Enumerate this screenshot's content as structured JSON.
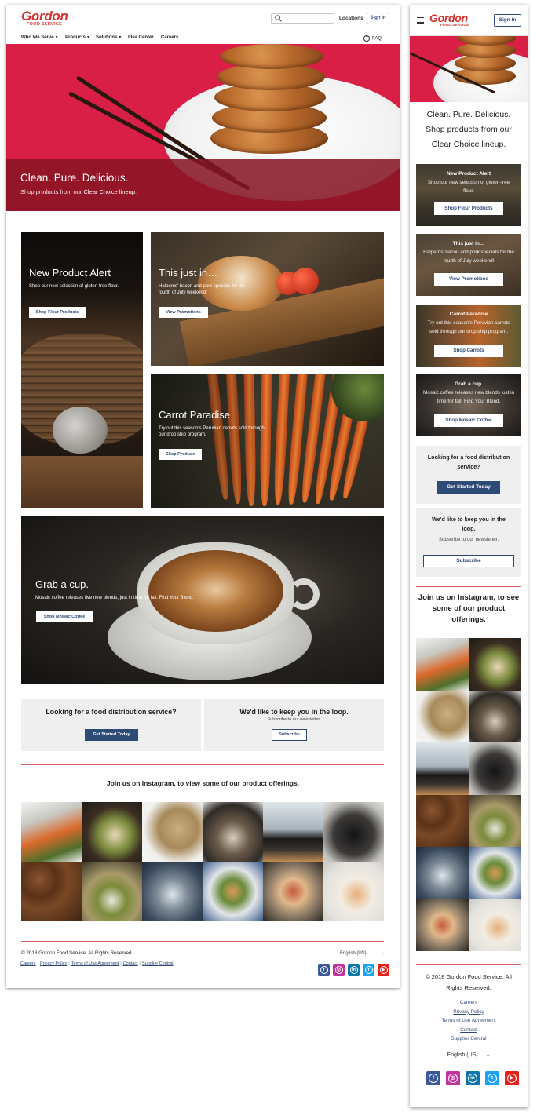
{
  "colors": {
    "brand_red": "#d1342e",
    "navy": "#2e4b78",
    "hero_red": "#d91f45",
    "hero_band": "#87141f",
    "info_gray": "#efefef",
    "divider_red": "#d66060",
    "facebook": "#3b5998",
    "instagram": "#c2339b",
    "linkedin": "#0e76a8",
    "twitter": "#1da1f2",
    "youtube": "#e62117"
  },
  "brand": {
    "name": "Gordon",
    "sub": "FOOD SERVICE"
  },
  "header": {
    "search_placeholder": "",
    "locations": "Locations",
    "sign_in": "Sign In",
    "faq": "FAQ",
    "nav": [
      {
        "label": "Who We Serve",
        "has_menu": true
      },
      {
        "label": "Products",
        "has_menu": true
      },
      {
        "label": "Solutions",
        "has_menu": true
      },
      {
        "label": "Idea Center",
        "has_menu": false
      },
      {
        "label": "Careers",
        "has_menu": false
      }
    ]
  },
  "hero": {
    "title": "Clean. Pure. Delicious.",
    "subtitle": "Shop products from our ",
    "link": "Clear Choice lineup",
    "period": ".",
    "mobile_line1": "Clean. Pure. Delicious.",
    "mobile_line2": "Shop products from our"
  },
  "promos": [
    {
      "title": "New Product Alert",
      "text": "Shop our new selection of gluten-free flour.",
      "button": "Shop Flour Products"
    },
    {
      "title": "This just in…",
      "text": "Halperns' bacon and pork specials for the fourth of July weekend!",
      "button": "View Promotions"
    },
    {
      "title": "Carrot Paradise",
      "text": "Try out this season's Peruvian carrots sold through our drop ship program.",
      "button": "Shop Produce"
    },
    {
      "title": "Grab a cup.",
      "text": "Mosaic coffee releases five new blends, just in time for fall. Find Your Blend.",
      "button": "Shop Mosaic Coffee"
    }
  ],
  "mobile_promos": [
    {
      "title": "New Product Alert",
      "text": "Shop our new selection of gluten-free flour.",
      "button": "Shop Flour Products"
    },
    {
      "title": "This just in…",
      "text": "Halperns' bacon and pork specials for the fourth of July weekend!",
      "button": "View Promotions"
    },
    {
      "title": "Carrot Paradise",
      "text": "Try out this season's Peruvian carrots sold through our drop ship program.",
      "button": "Shop Carrots"
    },
    {
      "title": "Grab a cup.",
      "text": "Mosaic coffee releases new blends just in time for fall. Find Your Blend.",
      "button": "Shop Mosaic Coffee"
    }
  ],
  "info": {
    "distribution": {
      "heading": "Looking for a food distribution service?",
      "button": "Get Started Today"
    },
    "newsletter": {
      "heading": "We'd like to keep you in the loop.",
      "sub": "Subscribe to our newsletter.",
      "button": "Subscribe"
    }
  },
  "instagram": {
    "heading": "Join us on Instagram, to view some of our product offerings.",
    "mobile_heading": "Join us on Instagram, to see some of our product offerings."
  },
  "footer": {
    "copyright": "© 2018 Gordon Food Service. All Rights Reserved.",
    "mobile_copyright": "© 2018 Gordon Food Service. All Rights Reserved.",
    "links": [
      "Careers",
      "Privacy Policy",
      "Terms of Use Agreement",
      "Contact",
      "Supplier Central"
    ],
    "language": "English (US)",
    "social": [
      "facebook-icon",
      "instagram-icon",
      "linkedin-icon",
      "twitter-icon",
      "youtube-icon"
    ]
  }
}
